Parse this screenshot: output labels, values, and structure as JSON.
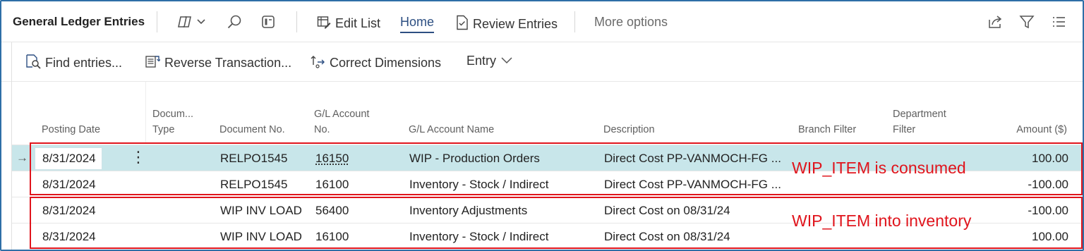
{
  "header": {
    "title": "General Ledger Entries",
    "tabs": [
      {
        "label": "Edit List",
        "icon": "edit-list-icon"
      },
      {
        "label": "Home",
        "icon": ""
      },
      {
        "label": "Review Entries",
        "icon": "review-entries-icon"
      },
      {
        "label": "More options",
        "icon": ""
      }
    ],
    "left_icons": [
      "copilot-icon",
      "search-icon",
      "filter-pane-icon"
    ],
    "right_icons": [
      "share-icon",
      "filter-icon",
      "list-view-icon"
    ]
  },
  "actions": [
    {
      "label": "Find entries...",
      "icon": "find-entries-icon"
    },
    {
      "label": "Reverse Transaction...",
      "icon": "reverse-transaction-icon"
    },
    {
      "label": "Correct Dimensions",
      "icon": "correct-dimensions-icon"
    },
    {
      "label": "Entry",
      "icon": "chevron-down-icon"
    }
  ],
  "columns": {
    "posting_date": "Posting Date",
    "doc_type_1": "Docum...",
    "doc_type_2": "Type",
    "document_no": "Document No.",
    "gl_account_no_1": "G/L Account",
    "gl_account_no_2": "No.",
    "gl_account_name": "G/L Account Name",
    "description": "Description",
    "branch_filter": "Branch Filter",
    "department_filter_1": "Department",
    "department_filter_2": "Filter",
    "amount": "Amount ($)"
  },
  "rows": [
    {
      "posting_date": "8/31/2024",
      "document_type": "",
      "document_no": "RELPO1545",
      "gl_account_no": "16150",
      "gl_account_name": "WIP - Production Orders",
      "description": "Direct Cost PP-VANMOCH-FG ...",
      "branch_filter": "",
      "department_filter": "",
      "amount": "100.00",
      "selected": true
    },
    {
      "posting_date": "8/31/2024",
      "document_type": "",
      "document_no": "RELPO1545",
      "gl_account_no": "16100",
      "gl_account_name": "Inventory - Stock / Indirect",
      "description": "Direct Cost PP-VANMOCH-FG ...",
      "branch_filter": "",
      "department_filter": "",
      "amount": "-100.00",
      "selected": false
    },
    {
      "posting_date": "8/31/2024",
      "document_type": "",
      "document_no": "WIP INV LOAD",
      "gl_account_no": "56400",
      "gl_account_name": "Inventory Adjustments",
      "description": "Direct Cost  on 08/31/24",
      "branch_filter": "",
      "department_filter": "",
      "amount": "-100.00",
      "selected": false
    },
    {
      "posting_date": "8/31/2024",
      "document_type": "",
      "document_no": "WIP INV LOAD",
      "gl_account_no": "16100",
      "gl_account_name": "Inventory - Stock / Indirect",
      "description": "Direct Cost  on 08/31/24",
      "branch_filter": "",
      "department_filter": "",
      "amount": "100.00",
      "selected": false
    }
  ],
  "annotations": {
    "group1_label": "WIP_ITEM is consumed",
    "group2_label": "WIP_ITEM into inventory",
    "color": "#e0141c"
  },
  "colors": {
    "accent": "#2d4f82",
    "selected_row": "#c8e6ea",
    "frame_border": "#2e6fa7"
  }
}
